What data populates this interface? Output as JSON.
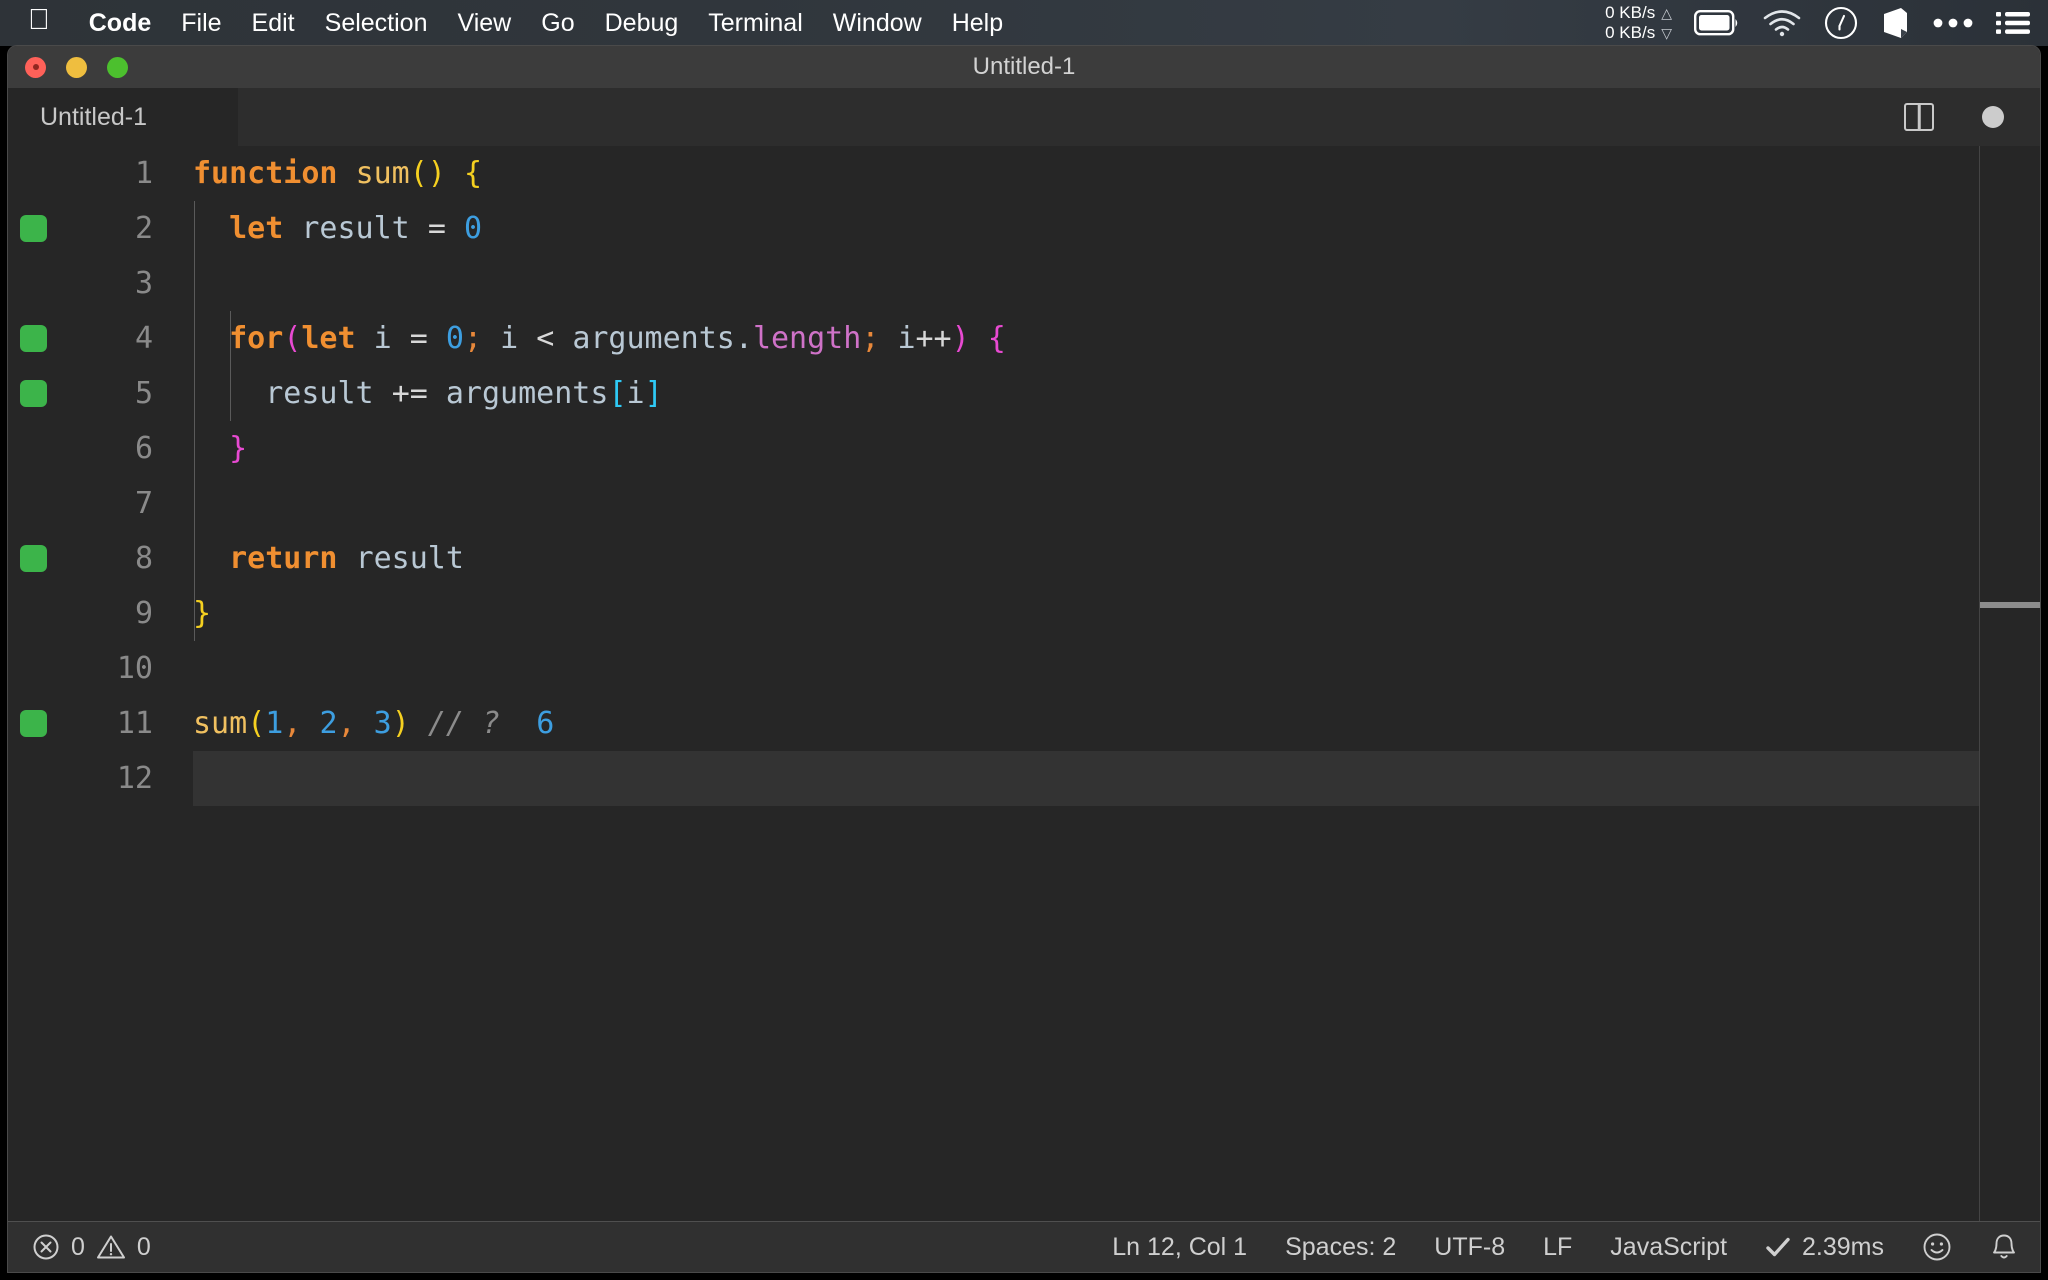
{
  "menubar": {
    "apple_glyph": "&#63743;",
    "items": [
      {
        "label": "Code",
        "bold": true
      },
      {
        "label": "File",
        "bold": false
      },
      {
        "label": "Edit",
        "bold": false
      },
      {
        "label": "Selection",
        "bold": false
      },
      {
        "label": "View",
        "bold": false
      },
      {
        "label": "Go",
        "bold": false
      },
      {
        "label": "Debug",
        "bold": false
      },
      {
        "label": "Terminal",
        "bold": false
      },
      {
        "label": "Window",
        "bold": false
      },
      {
        "label": "Help",
        "bold": false
      }
    ],
    "status": {
      "net_up": "0 KB/s",
      "net_down": "0 KB/s",
      "arrow_up": "△",
      "arrow_down": "▽",
      "icons": [
        "battery-icon",
        "wifi-icon",
        "speedometer-icon",
        "box-icon",
        "ellipsis-icon",
        "list-icon"
      ]
    }
  },
  "window": {
    "title": "Untitled-1",
    "traffic_lights": [
      "close-button",
      "minimize-button",
      "maximize-button"
    ]
  },
  "tabbar": {
    "tab_label": "Untitled-1",
    "split_editor_label": "split-editor-icon",
    "dirty_indicator_label": "unsaved-changes-dot"
  },
  "editor": {
    "language_colors": {
      "keyword": "#f08f31",
      "function": "#f0c060",
      "number": "#3d9ee0",
      "property": "#cf72c8",
      "bracket_yellow": "#f5d020",
      "bracket_magenta": "#e84ad2",
      "bracket_cyan": "#2fc9f5",
      "comment": "#8b8b8b",
      "text": "#b9c8d4",
      "background": "#262626",
      "gutter_marker": "#3cb44a"
    },
    "lines": [
      {
        "n": "1",
        "marker": false,
        "text": "function sum() {"
      },
      {
        "n": "2",
        "marker": true,
        "text": "  let result = 0"
      },
      {
        "n": "3",
        "marker": false,
        "text": ""
      },
      {
        "n": "4",
        "marker": true,
        "text": "  for(let i = 0; i < arguments.length; i++) {"
      },
      {
        "n": "5",
        "marker": true,
        "text": "    result += arguments[i]"
      },
      {
        "n": "6",
        "marker": false,
        "text": "  }"
      },
      {
        "n": "7",
        "marker": false,
        "text": ""
      },
      {
        "n": "8",
        "marker": true,
        "text": "  return result"
      },
      {
        "n": "9",
        "marker": false,
        "text": "}"
      },
      {
        "n": "10",
        "marker": false,
        "text": ""
      },
      {
        "n": "11",
        "marker": true,
        "text": "sum(1, 2, 3) // ?  6"
      },
      {
        "n": "12",
        "marker": false,
        "text": ""
      }
    ]
  },
  "statusbar": {
    "errors": "0",
    "warnings": "0",
    "cursor_position": "Ln 12, Col 1",
    "indentation": "Spaces: 2",
    "encoding": "UTF-8",
    "eol": "LF",
    "language": "JavaScript",
    "runtime": "2.39ms",
    "feedback_label": "smiley-icon",
    "notifications_label": "bell-icon"
  }
}
